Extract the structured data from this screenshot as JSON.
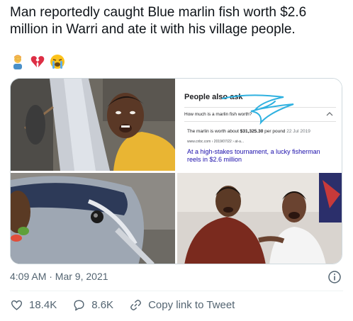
{
  "tweet": {
    "text": "Man reportedly caught Blue marlin fish worth $2.6 million in Warri and ate it with his village people.",
    "emojis": [
      "person-facepalming",
      "broken-heart",
      "loudly-crying-face"
    ]
  },
  "media": {
    "people_also_ask": {
      "title": "People also ask",
      "question": "How much is a marlin fish worth?",
      "answer_prefix": "The marlin is worth about ",
      "answer_value": "$31,325.30",
      "answer_suffix": " per pound",
      "answer_date": "22 Jul 2019",
      "source": "www.cnbc.com › 2019/07/22 › at-a...",
      "link_text": "At a high-stakes tournament, a lucky fisherman reels in $2.6 million"
    }
  },
  "meta": {
    "timestamp": "4:09 AM · Mar 9, 2021"
  },
  "actions": {
    "likes": "18.4K",
    "replies": "8.6K",
    "share_label": "Copy link to Tweet"
  },
  "colors": {
    "text": "#0f1419",
    "secondary": "#536471",
    "border": "#cfd9de",
    "link_blue": "#1a0dab"
  }
}
